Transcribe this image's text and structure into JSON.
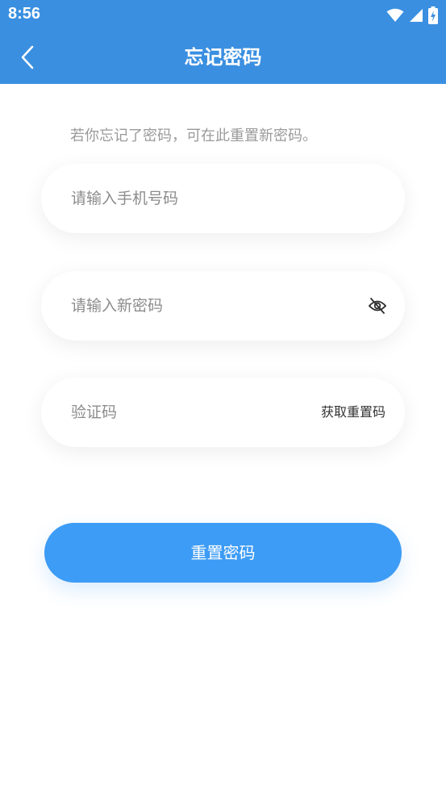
{
  "status_bar": {
    "time": "8:56",
    "icons": [
      "wifi-icon",
      "cell-signal-icon",
      "battery-charging-icon"
    ]
  },
  "header": {
    "title": "忘记密码",
    "back_icon": "chevron-left-icon"
  },
  "hint_text": "若你忘记了密码，可在此重置新密码。",
  "form": {
    "phone_placeholder": "请输入手机号码",
    "password_placeholder": "请输入新密码",
    "password_visibility_icon": "eye-off-icon",
    "code_placeholder": "验证码",
    "get_code_label": "获取重置码"
  },
  "submit_label": "重置密码",
  "colors": {
    "primary": "#3a8fe0",
    "button": "#3d9cf5"
  }
}
